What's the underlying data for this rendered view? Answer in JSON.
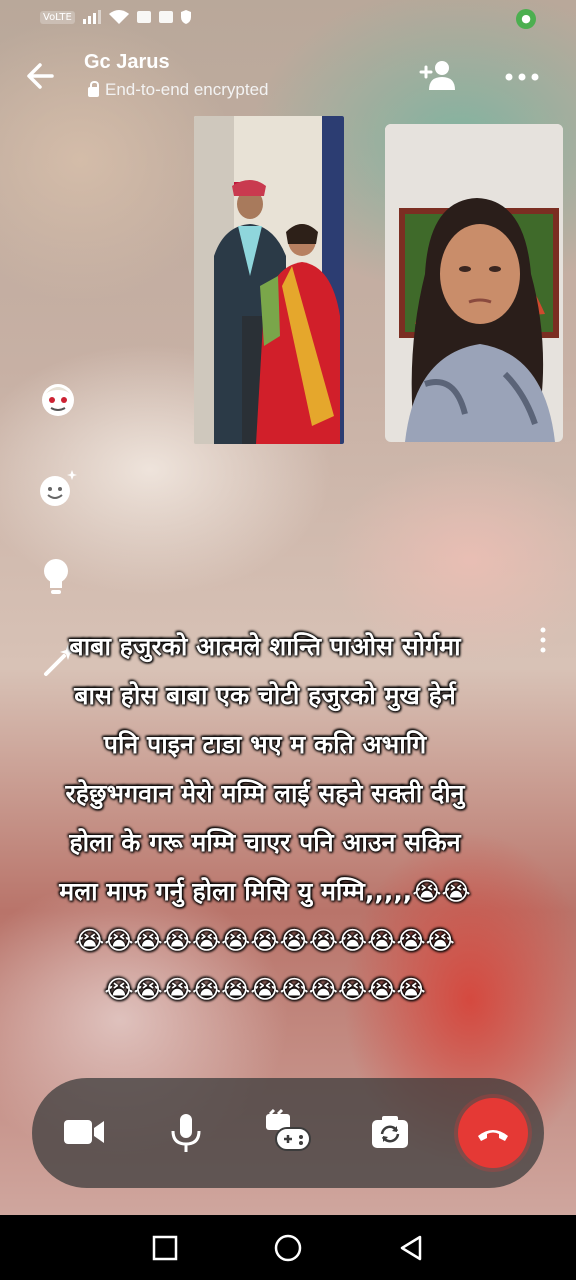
{
  "status_bar": {
    "volte_label": "VoLTE"
  },
  "header": {
    "title": "Gc Jarus",
    "subtitle": "End-to-end encrypted",
    "back_icon": "arrow-left-icon",
    "add_person_icon": "add-person-icon",
    "more_icon": "more-horizontal-icon"
  },
  "video_tiles": [
    {
      "name": "participant-video-couple"
    },
    {
      "name": "participant-video-woman"
    }
  ],
  "side_effects": [
    {
      "icon": "face-filter-icon"
    },
    {
      "icon": "sparkle-smiley-icon"
    },
    {
      "icon": "lightbulb-icon"
    },
    {
      "icon": "magic-wand-icon"
    }
  ],
  "caption": {
    "lines": [
      "बाबा हजुरको आत्मले शान्ति पाओस सोर्गमा",
      "बास होस बाबा एक चोटी हजुरको मुख हेर्न",
      "पनि पाइन टाडा भए म कति अभागि",
      "रहेछुभगवान मेरो मम्मि लाई सहने सक्ती दीनु",
      "होला के गरू मम्मि चाएर पनि आउन सकिन",
      "मला माफ गर्नु होला मिसि यु मम्मि,,,,,😭😭",
      "😭😭😭😭😭😭😭😭😭😭😭😭😭",
      "😭😭😭😭😭😭😭😭😭😭😭"
    ]
  },
  "controls": {
    "video_icon": "video-camera-icon",
    "mic_icon": "microphone-icon",
    "effects_icon": "game-effects-icon",
    "flip_icon": "flip-camera-icon",
    "end_icon": "end-call-icon",
    "end_color": "#e53935"
  },
  "nav_bar": {
    "recent_icon": "square-recent-icon",
    "home_icon": "circle-home-icon",
    "back_icon": "triangle-back-icon"
  }
}
